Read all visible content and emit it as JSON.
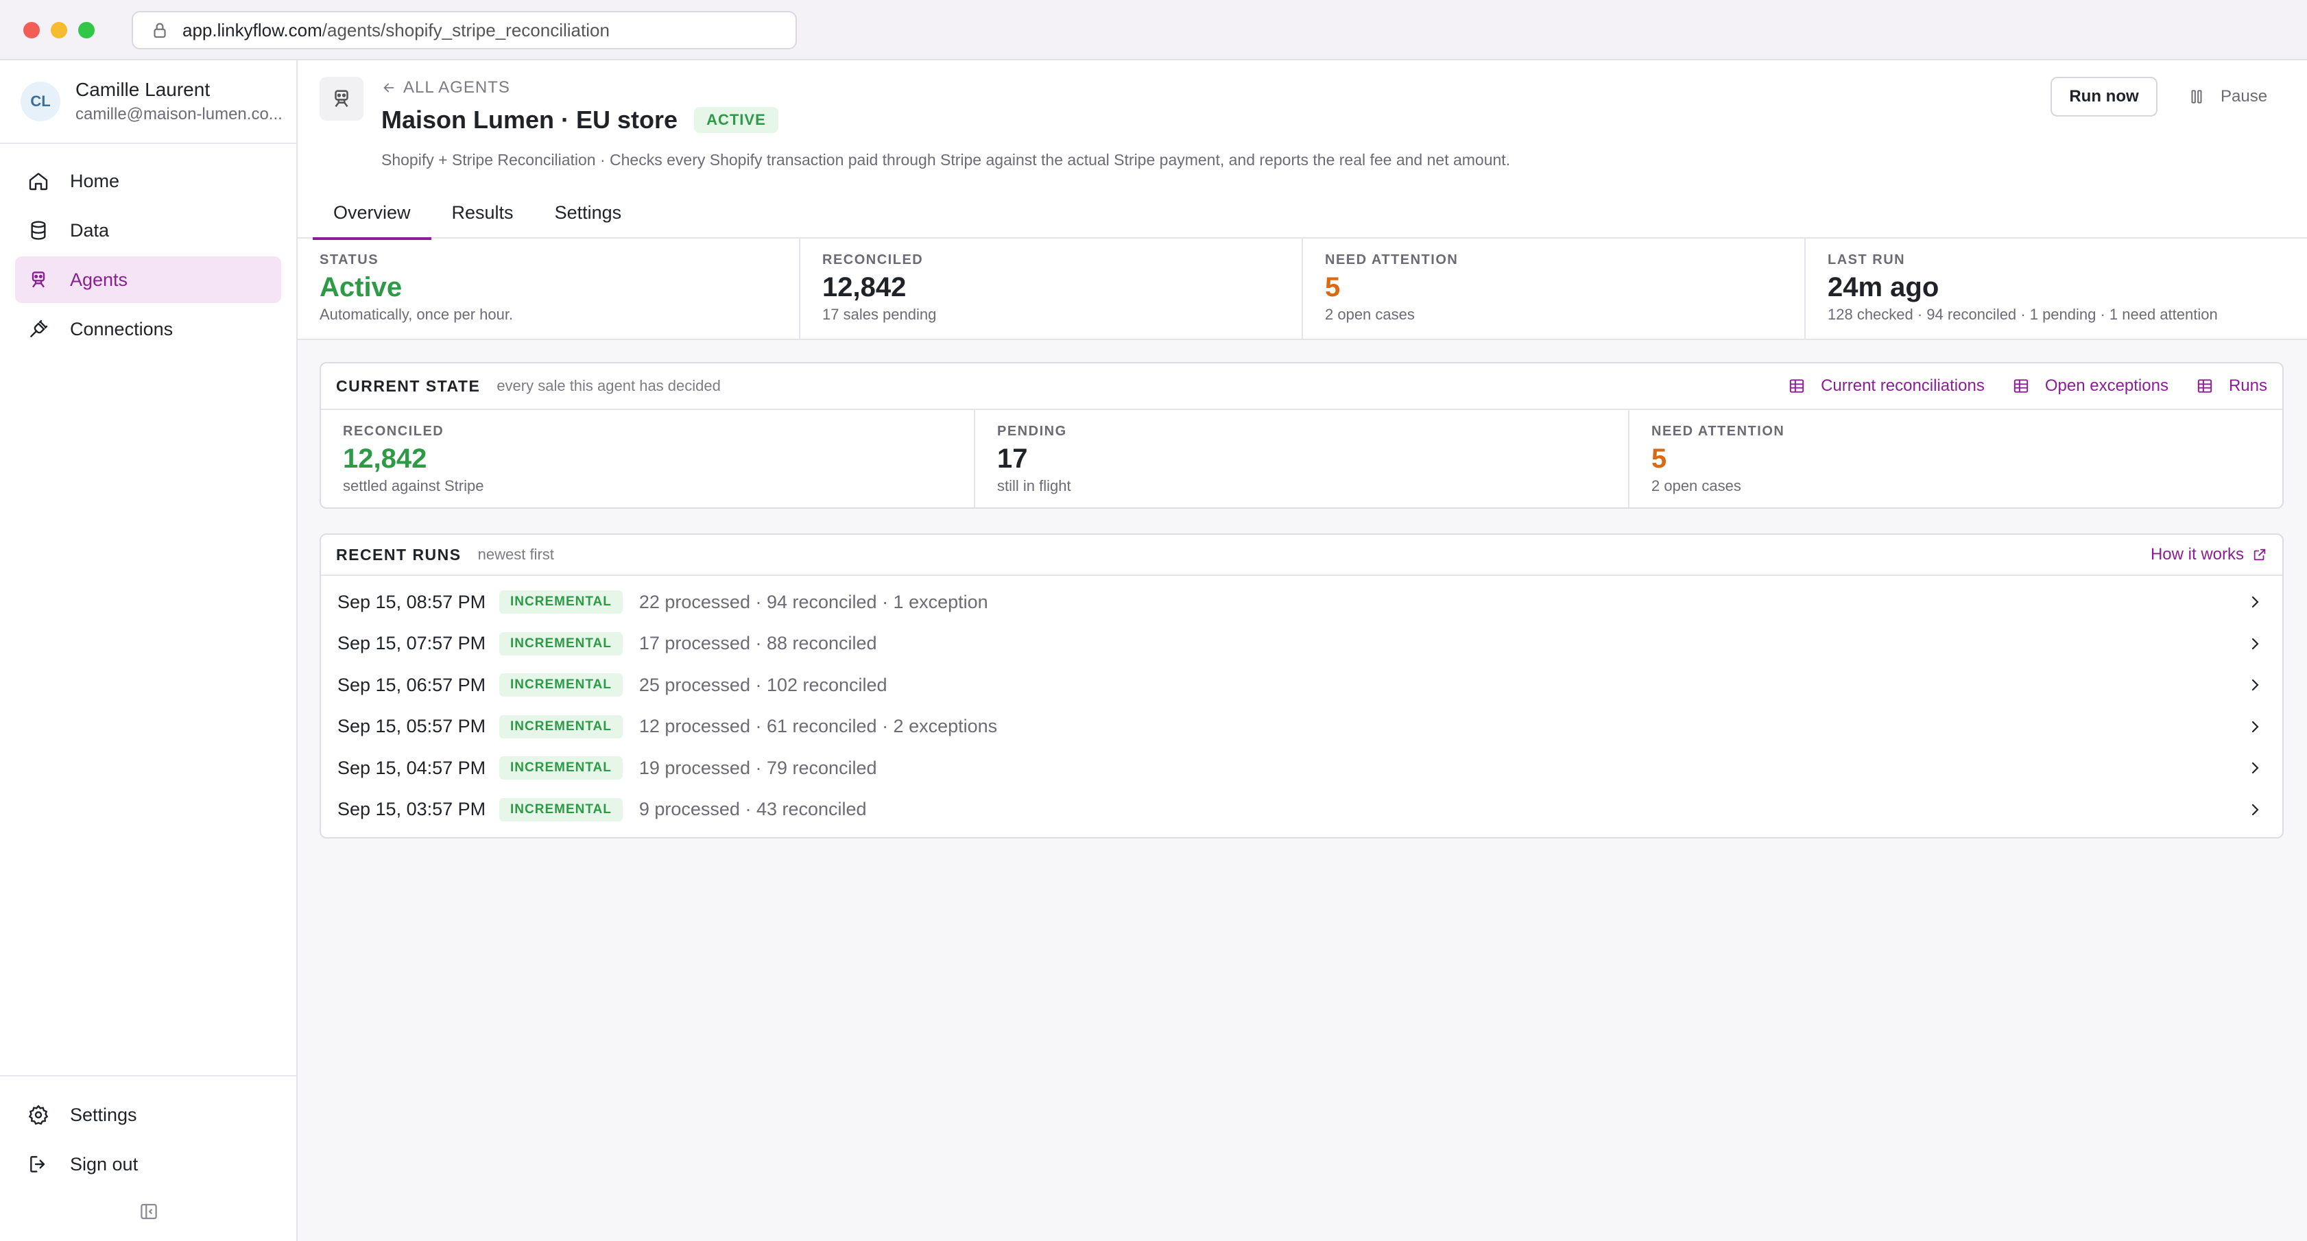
{
  "browser": {
    "url_host": "app.linkyflow.com",
    "url_path": "/agents/shopify_stripe_reconciliation"
  },
  "sidebar": {
    "user": {
      "initials": "CL",
      "name": "Camille Laurent",
      "email": "camille@maison-lumen.co..."
    },
    "nav": [
      {
        "label": "Home",
        "icon": "home-icon"
      },
      {
        "label": "Data",
        "icon": "database-icon"
      },
      {
        "label": "Agents",
        "icon": "agent-icon",
        "active": true
      },
      {
        "label": "Connections",
        "icon": "plug-icon"
      }
    ],
    "bottom": [
      {
        "label": "Settings",
        "icon": "gear-icon"
      },
      {
        "label": "Sign out",
        "icon": "sign-out-icon"
      }
    ]
  },
  "header": {
    "back_label": "ALL AGENTS",
    "title": "Maison Lumen · EU store",
    "status_badge": "ACTIVE",
    "description": "Shopify + Stripe Reconciliation · Checks every Shopify transaction paid through Stripe against the actual Stripe payment, and reports the real fee and net amount.",
    "run_now_label": "Run now",
    "pause_label": "Pause"
  },
  "tabs": [
    {
      "label": "Overview",
      "active": true
    },
    {
      "label": "Results"
    },
    {
      "label": "Settings"
    }
  ],
  "stats": {
    "status": {
      "label": "STATUS",
      "value": "Active",
      "sub": "Automatically, once per hour."
    },
    "reconciled": {
      "label": "RECONCILED",
      "value": "12,842",
      "sub": "17 sales pending"
    },
    "attention": {
      "label": "NEED ATTENTION",
      "value": "5",
      "sub": "2 open cases"
    },
    "last_run": {
      "label": "LAST RUN",
      "value": "24m ago",
      "sub": "128 checked · 94 reconciled · 1 pending · 1 need attention"
    }
  },
  "current_state": {
    "title": "CURRENT STATE",
    "subtitle": "every sale this agent has decided",
    "links": [
      "Current reconciliations",
      "Open exceptions",
      "Runs"
    ],
    "cells": {
      "reconciled": {
        "label": "RECONCILED",
        "value": "12,842",
        "sub": "settled against Stripe"
      },
      "pending": {
        "label": "PENDING",
        "value": "17",
        "sub": "still in flight"
      },
      "attention": {
        "label": "NEED ATTENTION",
        "value": "5",
        "sub": "2 open cases"
      }
    }
  },
  "recent_runs": {
    "title": "RECENT RUNS",
    "subtitle": "newest first",
    "help_link": "How it works",
    "rows": [
      {
        "date": "Sep 15, 08:57 PM",
        "type": "INCREMENTAL",
        "summary": "22 processed · 94 reconciled · 1 exception"
      },
      {
        "date": "Sep 15, 07:57 PM",
        "type": "INCREMENTAL",
        "summary": "17 processed · 88 reconciled"
      },
      {
        "date": "Sep 15, 06:57 PM",
        "type": "INCREMENTAL",
        "summary": "25 processed · 102 reconciled"
      },
      {
        "date": "Sep 15, 05:57 PM",
        "type": "INCREMENTAL",
        "summary": "12 processed · 61 reconciled · 2 exceptions"
      },
      {
        "date": "Sep 15, 04:57 PM",
        "type": "INCREMENTAL",
        "summary": "19 processed · 79 reconciled"
      },
      {
        "date": "Sep 15, 03:57 PM",
        "type": "INCREMENTAL",
        "summary": "9 processed · 43 reconciled"
      }
    ]
  },
  "colors": {
    "accent": "#8a1f94",
    "accent_bg": "#f5e3f6",
    "success": "#2d9a45",
    "warning": "#d96a12"
  }
}
